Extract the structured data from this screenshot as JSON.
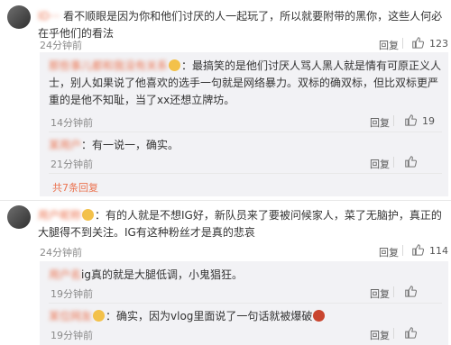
{
  "comments": [
    {
      "name": "ID···",
      "text": "看不顺眼是因为你和他们讨厌的人一起玩了，所以就要附带的黑你，这些人何必在乎他们的看法",
      "time": "24分钟前",
      "reply": "回复",
      "likes": "123",
      "replies": [
        {
          "name": "那些事儿都和我没有关系",
          "text": "：最搞笑的是他们讨厌人骂人黑人就是情有可原正义人士，别人如果说了他喜欢的选手一句就是网络暴力。双标的确双标，但比双标更严重的是他不知耻，当了xx还想立牌坊。",
          "time": "14分钟前",
          "reply": "回复",
          "likes": "19"
        },
        {
          "name": "某用户",
          "text": "：有一说一，确实。",
          "time": "21分钟前",
          "reply": "回复",
          "likes": ""
        }
      ],
      "more": "共7条回复"
    },
    {
      "name": "用户昵称",
      "text": "：有的人就是不想IG好，新队员来了要被问候家人，菜了无脑护，真正的大腿得不到关注。IG有这种粉丝才是真的悲哀",
      "time": "24分钟前",
      "reply": "回复",
      "likes": "114",
      "replies": [
        {
          "name": "用户名",
          "text": "ig真的就是大腿低调，小鬼猖狂。",
          "time": "19分钟前",
          "reply": "回复",
          "likes": ""
        },
        {
          "name": "某位网友",
          "text": "：确实，因为vlog里面说了一句话就被爆破",
          "time": "19分钟前",
          "reply": "回复",
          "likes": ""
        }
      ]
    }
  ],
  "icons": {
    "like": "thumbs-up-icon",
    "emoji": "emoji-icon"
  }
}
